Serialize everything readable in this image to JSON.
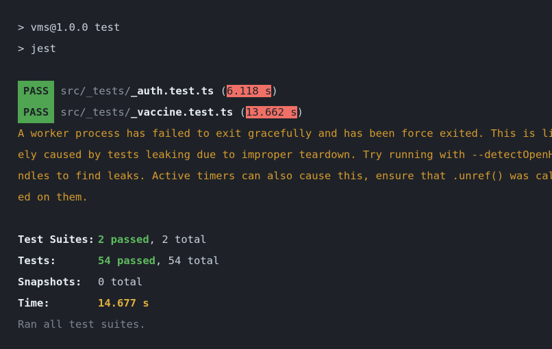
{
  "header": {
    "script_line": "> vms@1.0.0 test",
    "command_line": "> jest"
  },
  "results": [
    {
      "status": "PASS",
      "path_dir": "src/_tests/",
      "path_file": "_auth.test.ts",
      "open_paren": " (",
      "time": "6.118 s",
      "close_paren": ")"
    },
    {
      "status": "PASS",
      "path_dir": "src/_tests/",
      "path_file": "_vaccine.test.ts",
      "open_paren": " (",
      "time": "13.662 s",
      "close_paren": ")"
    }
  ],
  "warning_lines": [
    "A worker process has failed to exit gracefully and has been force exited. This is lik",
    "ely caused by tests leaking due to improper teardown. Try running with --detectOpenHa",
    "ndles to find leaks. Active timers can also cause this, ensure that .unref() was call",
    "ed on them."
  ],
  "summary": {
    "suites_label": "Test Suites:",
    "suites_passed": "2 passed",
    "suites_total": ", 2 total",
    "tests_label": "Tests:",
    "tests_passed": "54 passed",
    "tests_total": ", 54 total",
    "snapshots_label": "Snapshots:",
    "snapshots_value": "0 total",
    "time_label": "Time:",
    "time_value": "14.677 s",
    "footer": "Ran all test suites."
  },
  "colors": {
    "background": "#1e2228",
    "pass_badge": "#4fa551",
    "slow_highlight": "#f07067",
    "warning_text": "#d59a2e",
    "passed_text": "#5fbb5f",
    "time_text": "#e0b23a"
  }
}
